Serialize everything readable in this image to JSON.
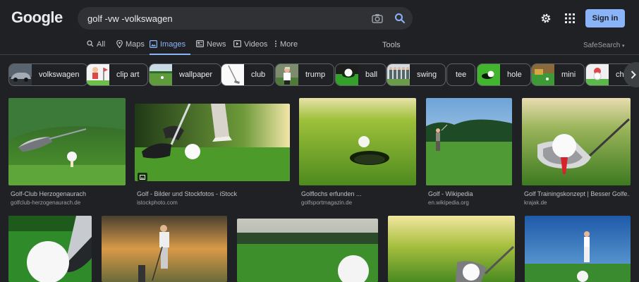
{
  "header": {
    "logo": "Google",
    "search_value": "golf -vw -volkswagen",
    "signin_label": "Sign in",
    "icons": [
      "camera-icon",
      "search-icon",
      "gear-icon",
      "apps-grid-icon"
    ]
  },
  "tabs": [
    {
      "label": "All",
      "icon": "search-icon",
      "active": false
    },
    {
      "label": "Maps",
      "icon": "map-pin-icon",
      "active": false
    },
    {
      "label": "Images",
      "icon": "image-icon",
      "active": true
    },
    {
      "label": "News",
      "icon": "news-icon",
      "active": false
    },
    {
      "label": "Videos",
      "icon": "play-icon",
      "active": false
    },
    {
      "label": "More",
      "icon": "more-vert-icon",
      "active": false
    }
  ],
  "tools_label": "Tools",
  "safesearch_label": "SafeSearch",
  "chips": [
    {
      "label": "volkswagen"
    },
    {
      "label": "clip art"
    },
    {
      "label": "wallpaper"
    },
    {
      "label": "club"
    },
    {
      "label": "trump"
    },
    {
      "label": "ball"
    },
    {
      "label": "swing"
    },
    {
      "label": "tee"
    },
    {
      "label": "hole"
    },
    {
      "label": "mini"
    },
    {
      "label": "chi"
    }
  ],
  "results": [
    {
      "title": "Golf-Club Herzogenaurach",
      "source": "golfclub-herzogenaurach.de"
    },
    {
      "title": "Golf - Bilder und Stockfotos - iStock",
      "source": "istockphoto.com"
    },
    {
      "title": "Golflochs erfunden ...",
      "source": "golfsportmagazin.de"
    },
    {
      "title": "Golf - Wikipedia",
      "source": "en.wikipedia.org"
    },
    {
      "title": "Golf Trainingskonzept | Besser Golfe...",
      "source": "krajak.de"
    }
  ],
  "colors": {
    "background": "#202124",
    "accent": "#8ab4f8",
    "grass": "#3f8f2a"
  }
}
